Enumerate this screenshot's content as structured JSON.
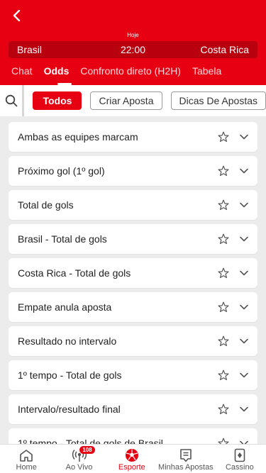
{
  "header": {
    "date_label": "Hoje",
    "home_team": "Brasil",
    "time": "22:00",
    "away_team": "Costa Rica"
  },
  "tabs": [
    {
      "label": "Chat"
    },
    {
      "label": "Odds"
    },
    {
      "label": "Confronto direto (H2H)"
    },
    {
      "label": "Tabela"
    }
  ],
  "filters": [
    {
      "label": "Todos"
    },
    {
      "label": "Criar Aposta"
    },
    {
      "label": "Dicas De Apostas"
    }
  ],
  "markets": [
    {
      "title": "Ambas as equipes marcam"
    },
    {
      "title": "Próximo gol (1º gol)"
    },
    {
      "title": "Total de gols"
    },
    {
      "title": "Brasil - Total de gols"
    },
    {
      "title": "Costa Rica - Total de gols"
    },
    {
      "title": "Empate anula aposta"
    },
    {
      "title": "Resultado no intervalo"
    },
    {
      "title": "1º tempo - Total de gols"
    },
    {
      "title": "Intervalo/resultado final"
    },
    {
      "title": "1º tempo - Total de gols de Brasil"
    }
  ],
  "bottom_nav": [
    {
      "label": "Home",
      "icon": "home-icon"
    },
    {
      "label": "Ao Vivo",
      "icon": "live-icon",
      "badge": "108"
    },
    {
      "label": "Esporte",
      "icon": "soccer-ball-icon"
    },
    {
      "label": "Minhas Apostas",
      "icon": "bet-slip-icon"
    },
    {
      "label": "Cassino",
      "icon": "cards-icon"
    }
  ],
  "colors": {
    "accent": "#e60012",
    "header_dark": "#b8000f",
    "background": "#ececec"
  }
}
